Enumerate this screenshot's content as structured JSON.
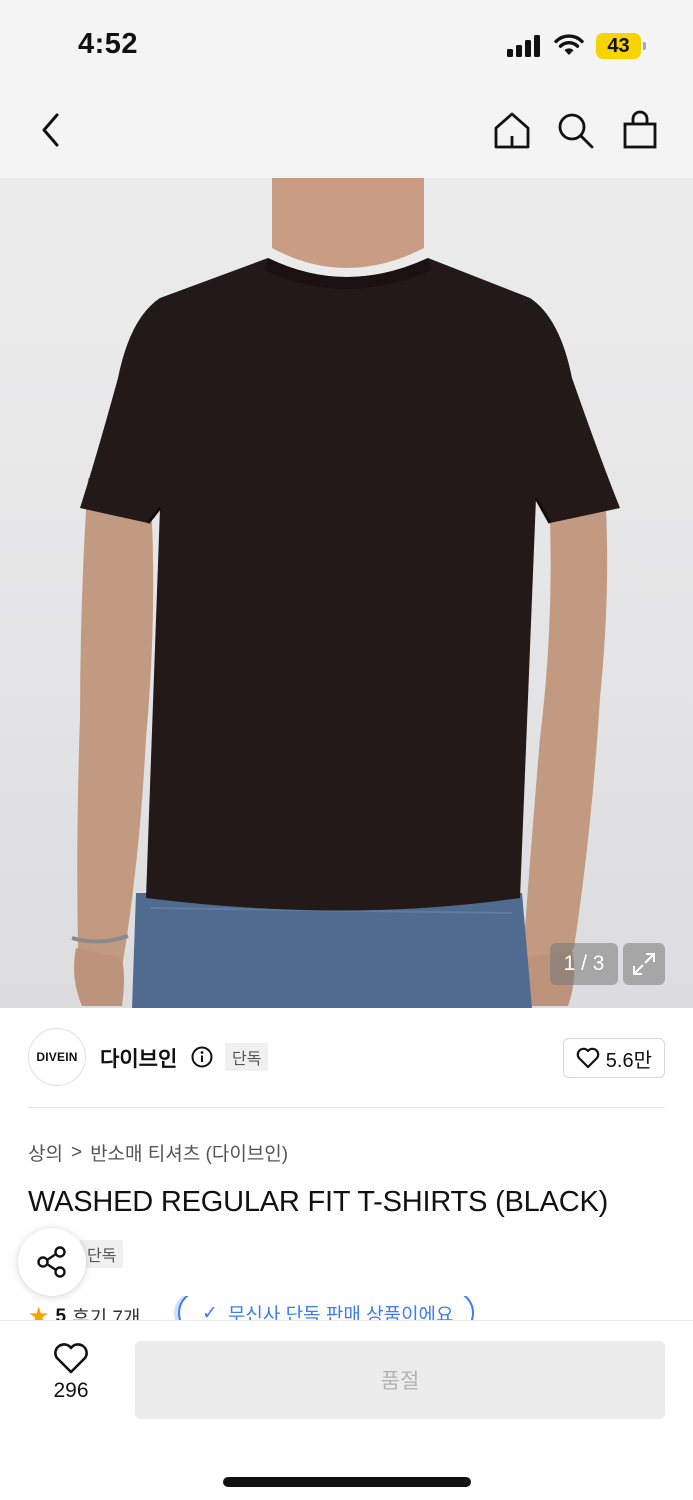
{
  "status_bar": {
    "time": "4:52",
    "battery": "43"
  },
  "brand": {
    "logo_text": "DIVEIN",
    "name": "다이브인",
    "tag": "단독",
    "like_count": "5.6만"
  },
  "gallery": {
    "counter": "1 / 3"
  },
  "breadcrumb": {
    "category": "상의",
    "separator": ">",
    "subcategory": "반소매 티셔츠 (다이브인)"
  },
  "product": {
    "title": "WASHED REGULAR FIT T-SHIRTS (BLACK)",
    "tag": "단독"
  },
  "rating": {
    "score": "5",
    "reviews": "후기 7개",
    "exclusive_banner": "무신사 단독 판매 상품이에요"
  },
  "bottom": {
    "wish_count": "296",
    "buy_label": "품절"
  },
  "colors": {
    "accent": "#3c7cf4",
    "battery": "#f7d400",
    "star": "#f7a200"
  }
}
